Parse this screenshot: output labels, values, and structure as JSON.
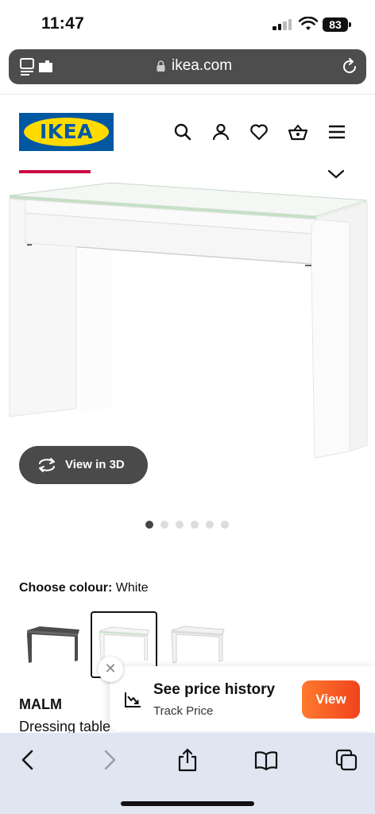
{
  "status_bar": {
    "time": "11:47",
    "battery": "83"
  },
  "browser": {
    "url": "ikea.com"
  },
  "header": {
    "logo_text": "IKEA"
  },
  "product": {
    "view_3d_label": "View in 3D",
    "carousel": {
      "count": 6,
      "active_index": 0
    },
    "colour_label": "Choose colour:",
    "colour_value": "White",
    "swatches": [
      {
        "name": "black-brown",
        "selected": false
      },
      {
        "name": "white",
        "selected": true
      },
      {
        "name": "white-grey",
        "selected": false
      }
    ],
    "name": "MALM",
    "description": "Dressing table"
  },
  "price_popup": {
    "title": "See price history",
    "subtitle": "Track Price",
    "view_label": "View"
  },
  "colors": {
    "ikea_blue": "#0058a3",
    "ikea_yellow": "#ffdb00",
    "tab_indicator": "#cc0a45",
    "view_button": "#f05a22"
  },
  "icons": [
    "tabs-icon",
    "lock-icon",
    "reload-icon",
    "search-icon",
    "account-icon",
    "heart-icon",
    "basket-icon",
    "menu-icon",
    "chevron-down-icon",
    "rotate-3d-icon",
    "close-icon",
    "price-chart-icon",
    "back-icon",
    "forward-icon",
    "share-icon",
    "bookmarks-icon",
    "tabs-overview-icon"
  ]
}
